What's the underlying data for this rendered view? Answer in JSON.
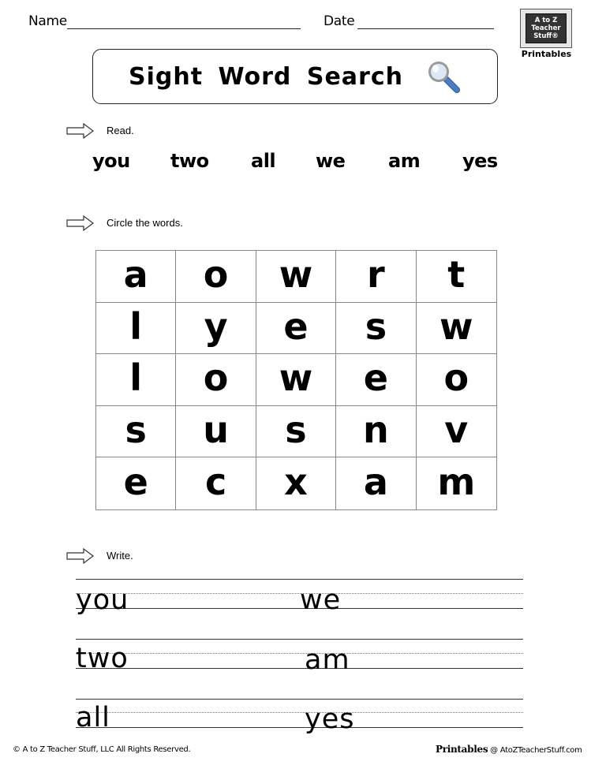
{
  "header": {
    "name_label": "Name",
    "date_label": "Date"
  },
  "logo": {
    "line1": "A to Z",
    "line2": "Teacher",
    "line3": "Stuff®",
    "caption": "Printables"
  },
  "title": {
    "text": "Sight Word Search",
    "icon": "magnifying-glass-icon"
  },
  "sections": {
    "read": {
      "instruction": "Read.",
      "icon": "right-arrow-icon"
    },
    "circle": {
      "instruction": "Circle the words.",
      "icon": "right-arrow-icon"
    },
    "write": {
      "instruction": "Write.",
      "icon": "right-arrow-icon"
    }
  },
  "sight_words": [
    "you",
    "two",
    "all",
    "we",
    "am",
    "yes"
  ],
  "grid": {
    "rows": [
      [
        "a",
        "o",
        "w",
        "r",
        "t"
      ],
      [
        "l",
        "y",
        "e",
        "s",
        "w"
      ],
      [
        "l",
        "o",
        "w",
        "e",
        "o"
      ],
      [
        "s",
        "u",
        "s",
        "n",
        "v"
      ],
      [
        "e",
        "c",
        "x",
        "a",
        "m"
      ]
    ]
  },
  "write_rows": [
    {
      "left": "you",
      "right": "we"
    },
    {
      "left": "two",
      "right": "am"
    },
    {
      "left": "all",
      "right": "yes"
    }
  ],
  "footer": {
    "copyright": "© A to Z Teacher Stuff, LLC   All Rights Reserved.",
    "brand": "Printables",
    "site": " @ AtoZTeacherStuff.com"
  },
  "colors": {
    "magnifier_handle": "#3f6fb0",
    "magnifier_rim": "#9a9a9a",
    "magnifier_glass": "#dce9f5",
    "logo_board": "#333333"
  }
}
